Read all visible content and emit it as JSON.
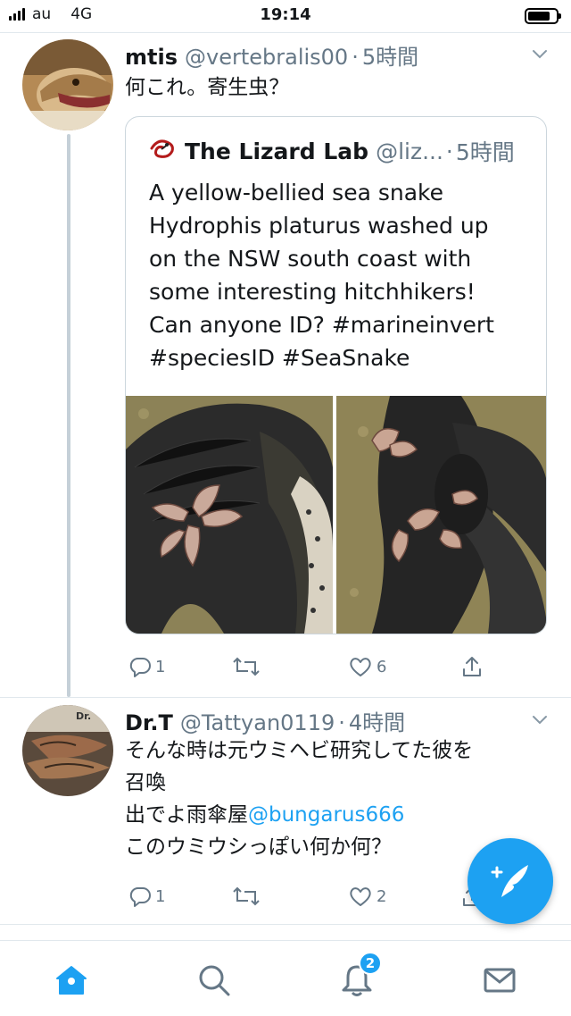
{
  "status_bar": {
    "carrier": "au",
    "network": "4G",
    "time": "19:14"
  },
  "colors": {
    "accent": "#1da1f2",
    "secondary_text": "#657786",
    "primary_text": "#14171a",
    "thread_line": "#c5d0d8"
  },
  "tweet1": {
    "name": "mtis",
    "handle": "@vertebralis00",
    "separator": "·",
    "time": "5時間",
    "text": "何これ。寄生虫？",
    "quote": {
      "name": "The Lizard Lab",
      "handle": "@liz...",
      "separator": "·",
      "time": "5時間",
      "text_lines": [
        "A yellow-bellied sea snake",
        "Hydrophis  platurus washed up",
        "on the NSW south coast with",
        "some interesting hitchhikers!",
        "Can anyone ID? #marineinvert",
        "#speciesID #SeaSnake"
      ]
    },
    "actions": {
      "reply_count": "1",
      "retweet_count": "",
      "like_count": "6"
    }
  },
  "tweet2": {
    "name": "Dr.T",
    "handle": "@Tattyan0119",
    "separator": "·",
    "time": "4時間",
    "line1": "そんな時は元ウミヘビ研究してた彼を",
    "line2": "召喚",
    "line3_prefix": "出でよ雨傘屋",
    "line3_mention": "@bungarus666",
    "line4": "このウミウシっぽい何か何？",
    "actions": {
      "reply_count": "1",
      "retweet_count": "",
      "like_count": "2"
    }
  },
  "bottom_nav": {
    "items": [
      "home-icon",
      "search-icon",
      "notifications-icon",
      "messages-icon"
    ],
    "notifications_badge": "2"
  },
  "fab": {
    "icon": "compose-tweet-icon"
  }
}
